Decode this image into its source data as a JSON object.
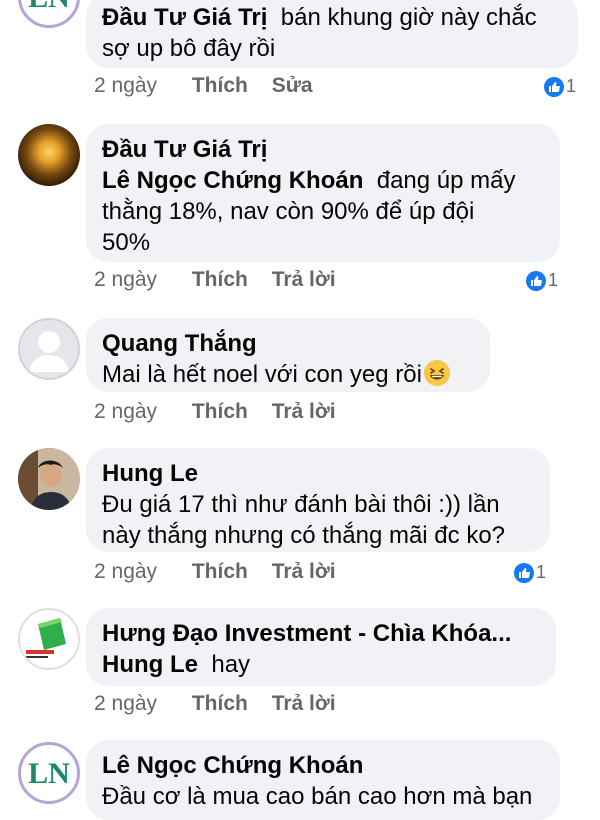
{
  "comments": [
    {
      "author": "Đầu Tư Giá Trị",
      "text_line1": "bán khung giờ này chắc",
      "text_line2": "sợ up bô đây rồi",
      "time": "2 ngày",
      "like": "Thích",
      "action2": "Sửa",
      "reactions": "1"
    },
    {
      "author": "Đầu Tư Giá Trị",
      "mention": "Lê Ngọc Chứng Khoán",
      "text_line1": "đang úp mấy",
      "text_line2": "thằng 18%,  nav còn 90% để úp đội",
      "text_line3": "50%",
      "time": "2 ngày",
      "like": "Thích",
      "action2": "Trả lời",
      "reactions": "1"
    },
    {
      "author": "Quang Thắng",
      "text_line1": "Mai là hết noel với con yeg rồi",
      "emoji": "grinning-squinting-face",
      "time": "2 ngày",
      "like": "Thích",
      "action2": "Trả lời"
    },
    {
      "author": "Hung Le",
      "text_line1": "Đu giá 17 thì như đánh bài thôi :)) lần",
      "text_line2": "này thắng nhưng có thắng mãi đc ko?",
      "time": "2 ngày",
      "like": "Thích",
      "action2": "Trả lời",
      "reactions": "1"
    },
    {
      "author": "Hưng Đạo Investment - Chìa Khóa...",
      "mention": "Hung Le",
      "text_line1": "hay",
      "time": "2 ngày",
      "like": "Thích",
      "action2": "Trả lời"
    },
    {
      "author": "Lê Ngọc Chứng Khoán",
      "text_line1": "Đầu cơ là mua cao bán cao hơn mà bạn"
    }
  ],
  "avatars": {
    "ln_logo_text": "LN"
  },
  "colors": {
    "bubble": "#f0f2f5",
    "meta": "#65676b",
    "like_blue": "#1877f2"
  }
}
